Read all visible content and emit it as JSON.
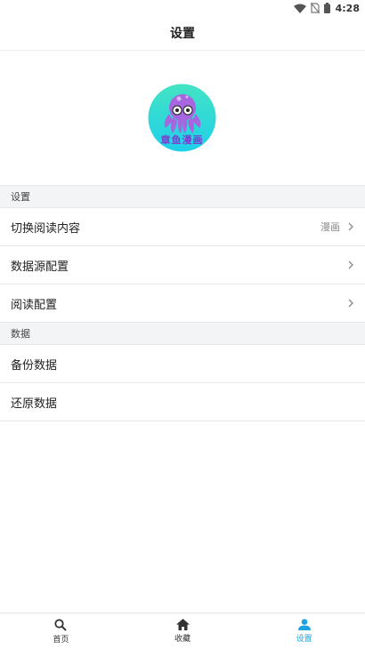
{
  "status_bar": {
    "time": "4:28",
    "icons": [
      "wifi-icon",
      "no-sim-icon",
      "battery-icon"
    ]
  },
  "header": {
    "title": "设置"
  },
  "logo": {
    "text": "章鱼漫画",
    "icon": "octopus-logo",
    "colors": {
      "background_top": "#3fe0c8",
      "background_bottom": "#22d3e8",
      "octopus": "#a768e0",
      "text": "#7a3ed0"
    }
  },
  "sections": [
    {
      "label": "设置",
      "rows": [
        {
          "label": "切换阅读内容",
          "value": "漫画",
          "chevron": true
        },
        {
          "label": "数据源配置",
          "value": "",
          "chevron": true
        },
        {
          "label": "阅读配置",
          "value": "",
          "chevron": true
        }
      ]
    },
    {
      "label": "数据",
      "rows": [
        {
          "label": "备份数据",
          "value": "",
          "chevron": false
        },
        {
          "label": "还原数据",
          "value": "",
          "chevron": false
        }
      ]
    }
  ],
  "tabbar": {
    "accent": "#1fa3e0",
    "tabs": [
      {
        "label": "首页",
        "icon": "search-icon",
        "active": false
      },
      {
        "label": "收藏",
        "icon": "home-icon",
        "active": false
      },
      {
        "label": "设置",
        "icon": "person-icon",
        "active": true
      }
    ]
  }
}
